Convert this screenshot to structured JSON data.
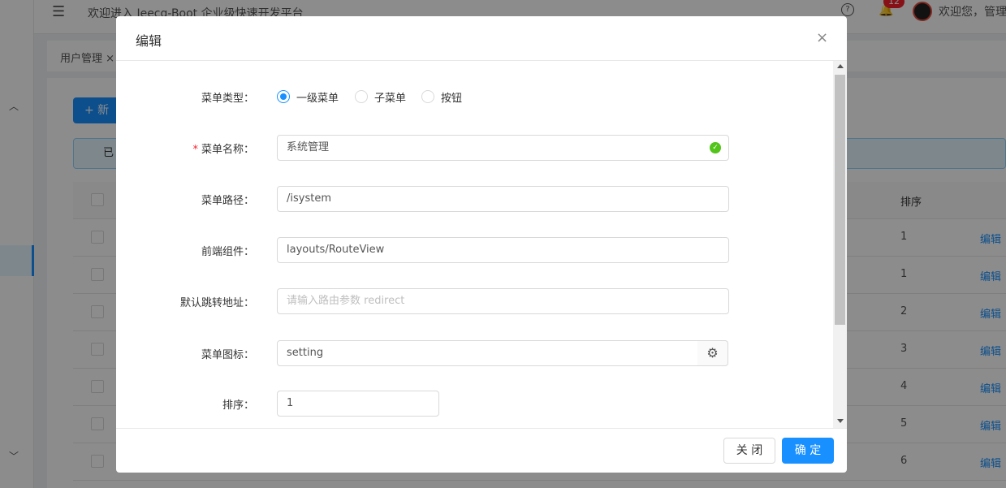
{
  "header": {
    "welcome": "欢迎进入 Jeecg-Boot 企业级快速开发平台",
    "notification_count": "12",
    "user_greeting": "欢迎您，管理"
  },
  "tabs": [
    {
      "label": "用户管理 ×"
    }
  ],
  "background": {
    "add_button_label": "+ 新",
    "alert_text": "已",
    "sort_header": "排序",
    "rows": [
      {
        "sort": "1",
        "action": "编辑"
      },
      {
        "sort": "1",
        "action": "编辑"
      },
      {
        "sort": "2",
        "action": "编辑"
      },
      {
        "sort": "3",
        "action": "编辑"
      },
      {
        "sort": "4",
        "action": "编辑"
      },
      {
        "sort": "5",
        "action": "编辑"
      },
      {
        "sort": "6",
        "action": "编辑"
      }
    ]
  },
  "modal": {
    "title": "编辑",
    "close_icon": "×",
    "fields": {
      "menu_type": {
        "label": "菜单类型",
        "options": [
          "一级菜单",
          "子菜单",
          "按钮"
        ],
        "selected": "一级菜单"
      },
      "menu_name": {
        "label": "菜单名称",
        "value": "系统管理",
        "required": true
      },
      "menu_path": {
        "label": "菜单路径",
        "value": "/isystem"
      },
      "component": {
        "label": "前端组件",
        "value": "layouts/RouteView"
      },
      "redirect": {
        "label": "默认跳转地址",
        "placeholder": "请输入路由参数 redirect"
      },
      "icon": {
        "label": "菜单图标",
        "value": "setting"
      },
      "sort": {
        "label": "排序",
        "value": "1"
      }
    },
    "footer": {
      "close_label": "关 闭",
      "ok_label": "确 定"
    }
  },
  "colors": {
    "primary": "#1890ff",
    "success": "#52c41a",
    "danger": "#f5222d"
  }
}
